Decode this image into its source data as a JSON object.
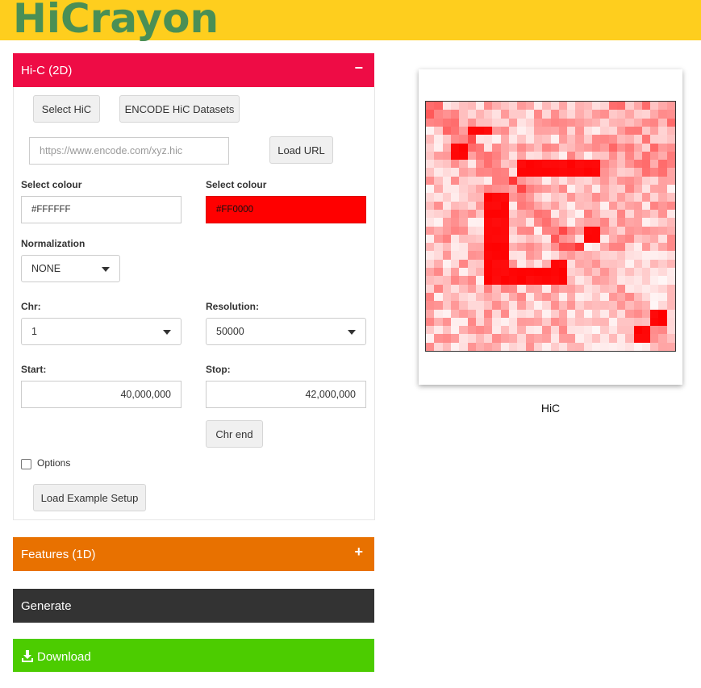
{
  "header": {
    "logo_text": "HiCrayon"
  },
  "hic_panel": {
    "title": "Hi-C (2D)",
    "toggle": "−",
    "select_hic_label": "Select HiC",
    "encode_label": "ENCODE HiC Datasets",
    "url_placeholder": "https://www.encode.com/xyz.hic",
    "load_url_label": "Load URL",
    "colour_low": {
      "label": "Select colour",
      "value": "#FFFFFF"
    },
    "colour_high": {
      "label": "Select colour",
      "value": "#FF0000"
    },
    "normalization": {
      "label": "Normalization",
      "value": "NONE"
    },
    "chr": {
      "label": "Chr:",
      "value": "1"
    },
    "resolution": {
      "label": "Resolution:",
      "value": "50000"
    },
    "start": {
      "label": "Start:",
      "value": "40,000,000"
    },
    "stop": {
      "label": "Stop:",
      "value": "42,000,000"
    },
    "chr_end_label": "Chr end",
    "options_label": "Options",
    "example_label": "Load Example Setup"
  },
  "features_panel": {
    "title": "Features (1D)",
    "toggle": "+"
  },
  "generate_panel": {
    "title": "Generate"
  },
  "download_panel": {
    "title": "Download"
  },
  "plot": {
    "caption": "HiC",
    "low_color": "#ffffff",
    "high_color": "#ff0000"
  },
  "colors": {
    "accent_red": "#ee0c45",
    "features_orange": "#e87100",
    "download_green": "#4ccc00",
    "topbar_yellow": "#fece1e",
    "logo_green": "#4a8f55"
  }
}
